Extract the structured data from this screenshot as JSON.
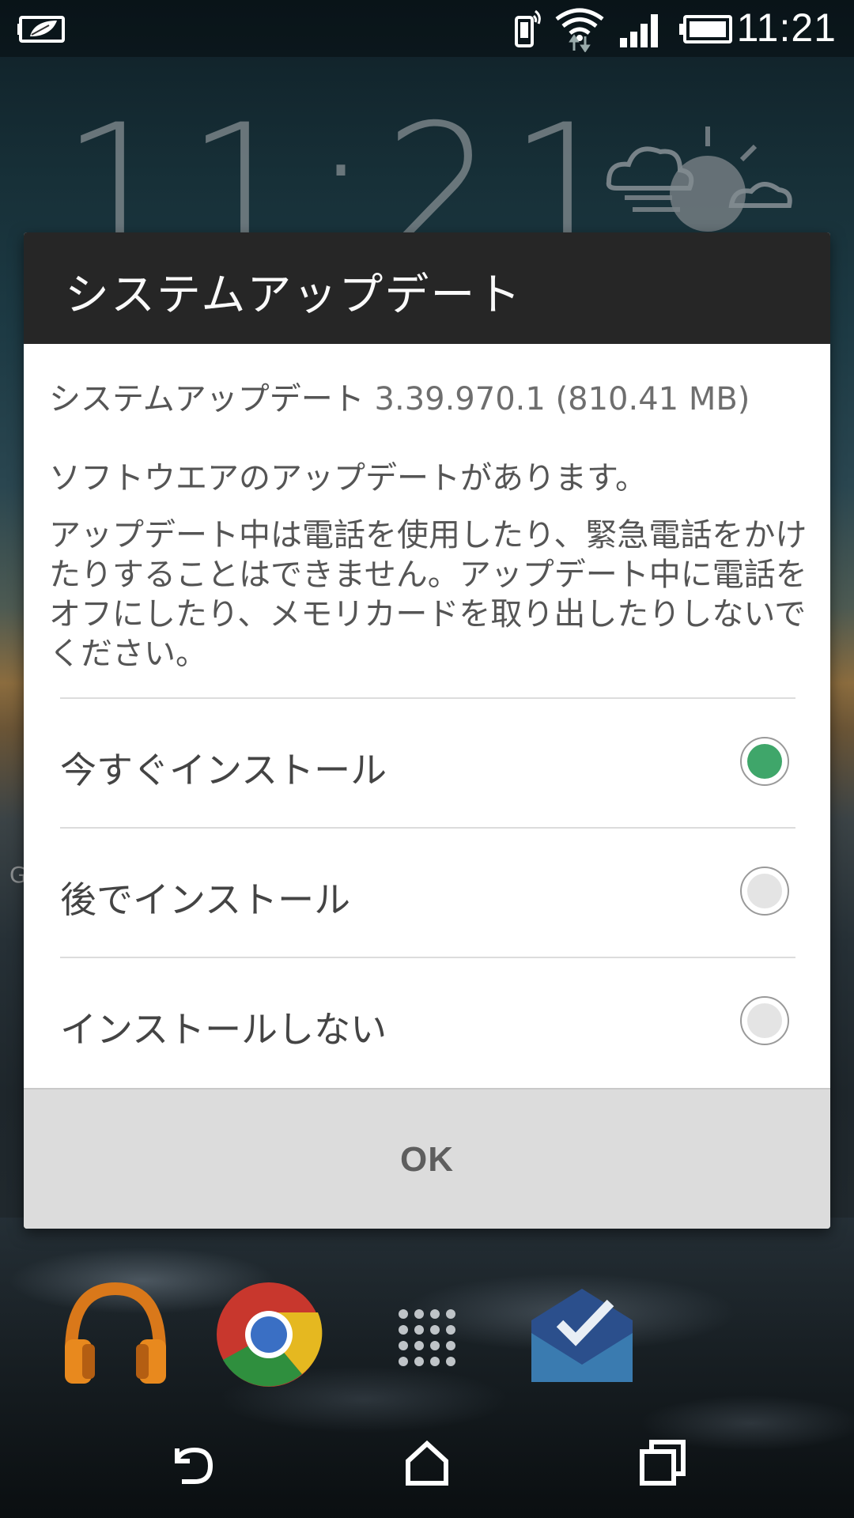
{
  "status_bar": {
    "time": "11:21",
    "icons": [
      "battery-saver-icon",
      "phone-vibrate-icon",
      "wifi-icon",
      "signal-icon",
      "battery-icon"
    ]
  },
  "lockscreen": {
    "clock": "11:21",
    "weather_icon": "partly-sunny-icon",
    "side_text": "G"
  },
  "dialog": {
    "title": "システムアップデート",
    "version_label": "システムアップデート",
    "version_value": "3.39.970.1 (810.41 MB)",
    "available_message": "ソフトウエアのアップデートがあります。",
    "warning_message": "アップデート中は電話を使用したり、緊急電話をかけたりすることはできません。アップデート中に電話をオフにしたり、メモリカードを取り出したりしないでください。",
    "options": [
      {
        "label": "今すぐインストール",
        "selected": true
      },
      {
        "label": "後でインストール",
        "selected": false
      },
      {
        "label": "インストールしない",
        "selected": false
      }
    ],
    "ok_label": "OK",
    "accent_color": "#3fa66a"
  },
  "dock": {
    "icons": [
      "play-music-icon",
      "chrome-icon",
      "app-drawer-icon",
      "inbox-icon"
    ]
  },
  "nav_bar": {
    "icons": [
      "back-icon",
      "home-icon",
      "recents-icon"
    ]
  }
}
